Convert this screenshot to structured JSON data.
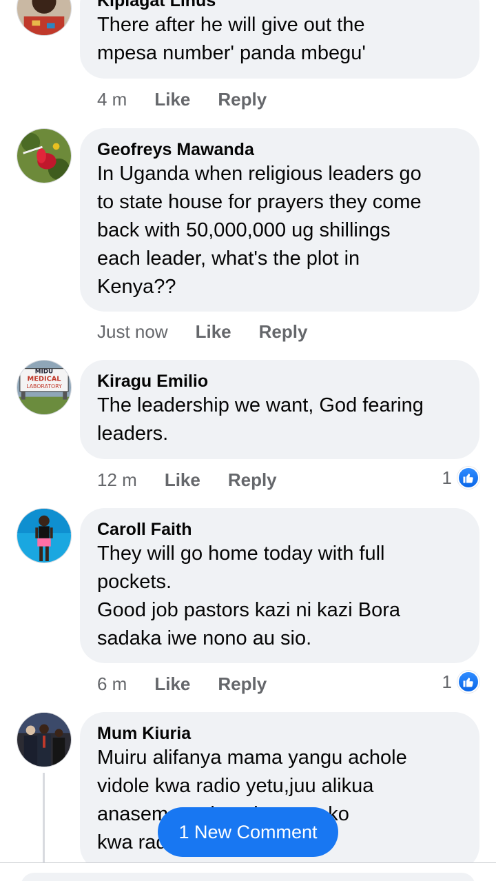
{
  "comments": [
    {
      "author": "Kiplagat Linus",
      "text": "There after he will give out the\nmpesa number' panda mbegu'",
      "time": "4 m",
      "like_label": "Like",
      "reply_label": "Reply"
    },
    {
      "author": "Geofreys Mawanda",
      "text": "In Uganda when religious leaders go\nto state house for prayers they come\nback with 50,000,000 ug shillings\neach leader, what's the plot in\nKenya??",
      "time": "Just now",
      "like_label": "Like",
      "reply_label": "Reply"
    },
    {
      "author": "Kiragu Emilio",
      "text": "The leadership we want, God fearing\nleaders.",
      "time": "12 m",
      "like_label": "Like",
      "reply_label": "Reply",
      "reaction_count": "1"
    },
    {
      "author": "Caroll Faith",
      "text": "They will go home today with full\npockets.\nGood job pastors kazi ni kazi Bora\nsadaka iwe nono au sio.",
      "time": "6 m",
      "like_label": "Like",
      "reply_label": "Reply",
      "reaction_count": "1"
    },
    {
      "author": "Mum Kiuria",
      "text": "Muiru alifanya mama yangu achole\nvidole kwa radio yetu,juu alikua\nanasema weka mkono wako\nkwa radio nikuombee😏"
    }
  ],
  "new_comment_button": "1 New Comment",
  "avatar_texts": {
    "lab_top": "MIDU",
    "lab_mid": "MEDICAL",
    "lab_bot": "LABORATORY"
  },
  "colors": {
    "accent": "#1877f2",
    "bubble": "#f0f2f5",
    "muted": "#65676b"
  }
}
